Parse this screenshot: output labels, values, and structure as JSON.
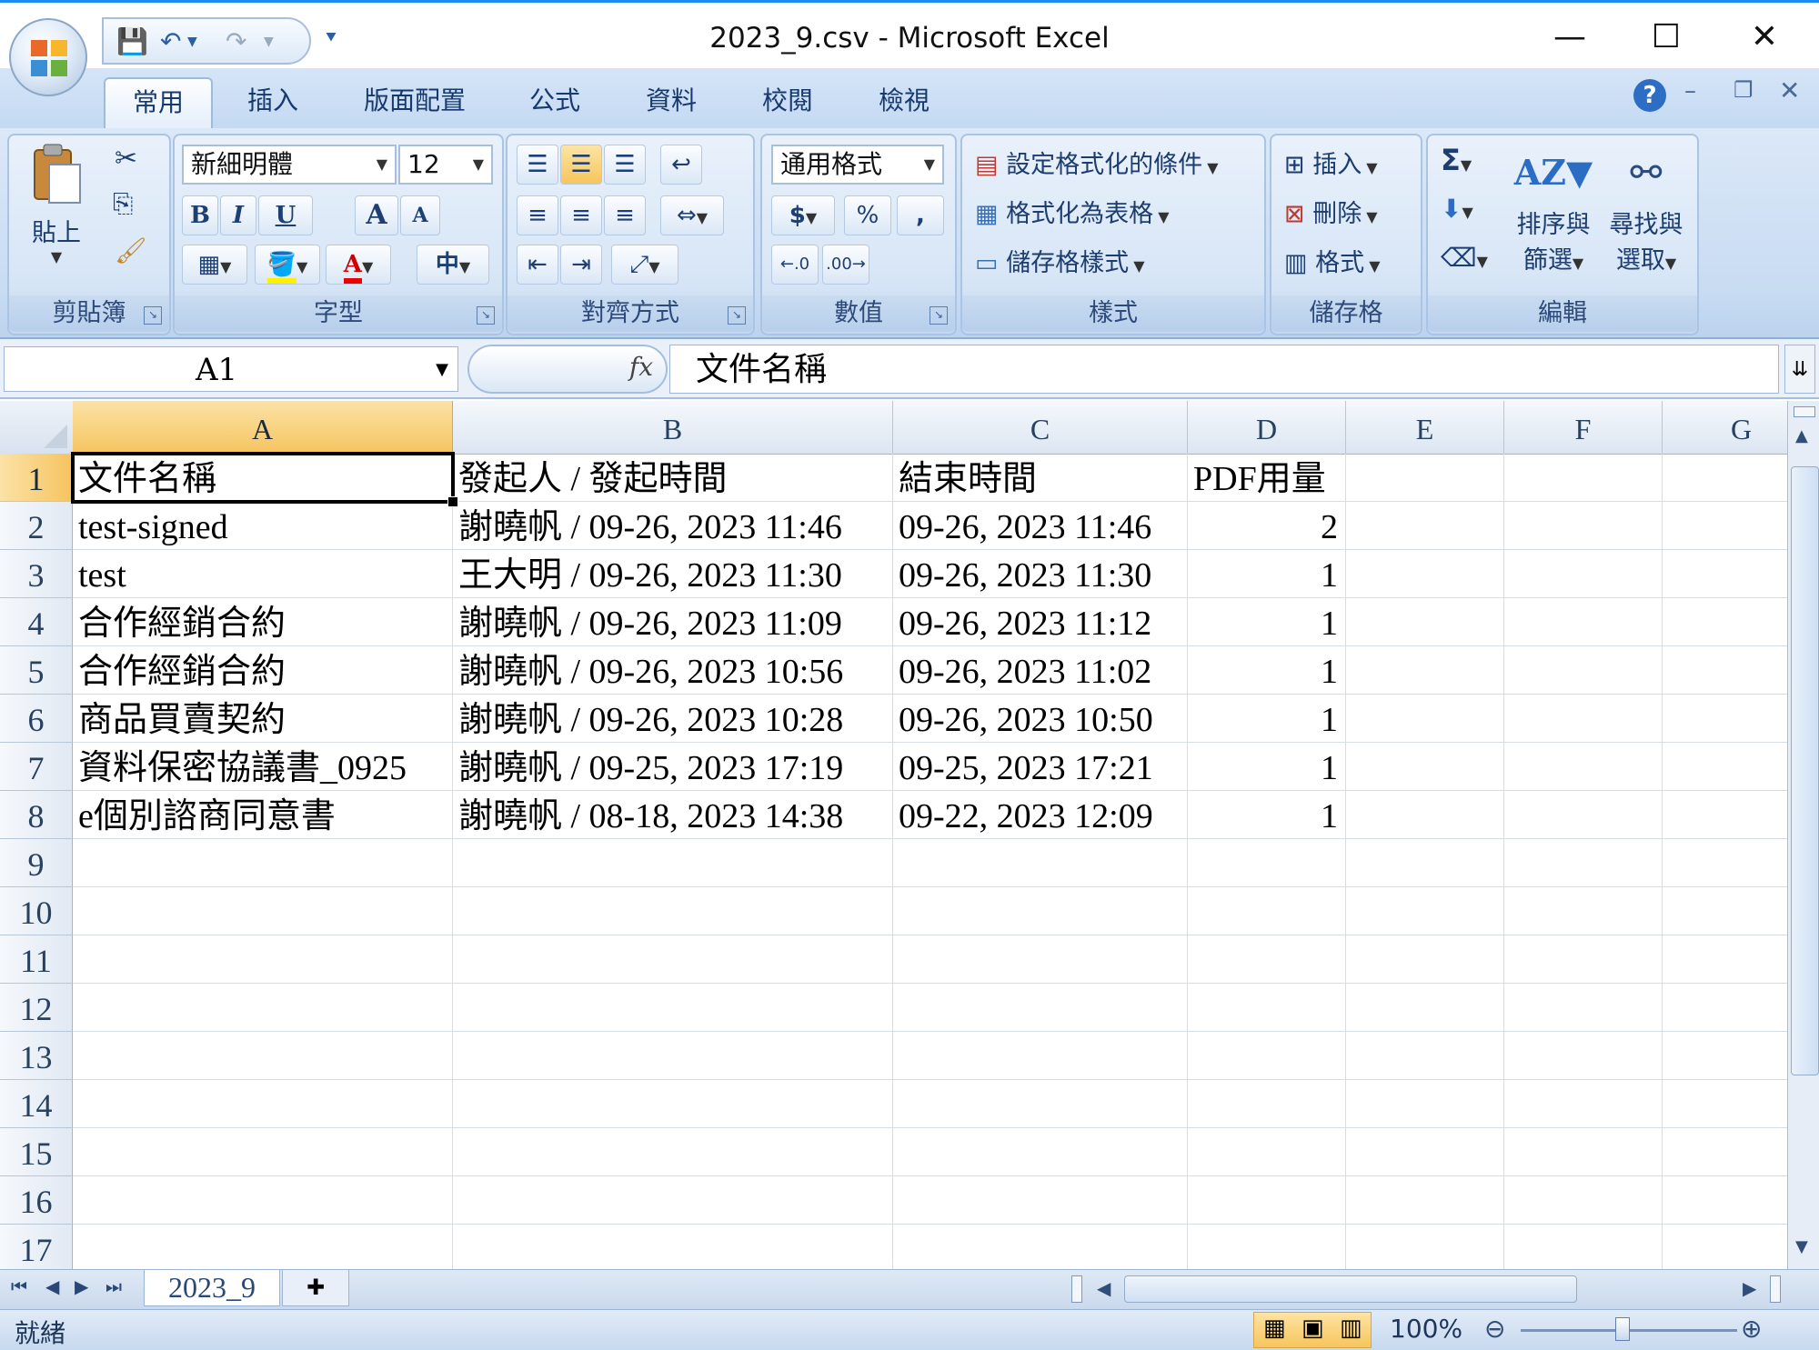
{
  "window": {
    "title": "2023_9.csv - Microsoft Excel",
    "minimize": "—",
    "maximize": "☐",
    "close": "✕"
  },
  "qat": {
    "save": "💾",
    "undo": "↶",
    "redo": "↷",
    "customize": "⯆"
  },
  "tabs": [
    "常用",
    "插入",
    "版面配置",
    "公式",
    "資料",
    "校閱",
    "檢視"
  ],
  "ribbon": {
    "clipboard": {
      "label": "剪貼簿",
      "paste": "貼上"
    },
    "font": {
      "label": "字型",
      "name": "新細明體",
      "size": "12",
      "bold": "B",
      "italic": "I",
      "underline": "U",
      "grow": "A",
      "shrink": "A",
      "phonetic": "中"
    },
    "alignment": {
      "label": "對齊方式"
    },
    "number": {
      "label": "數值",
      "format": "通用格式",
      "currency": "$",
      "percent": "%",
      "comma": ",",
      "inc": "←.0",
      "dec": ".00→"
    },
    "styles": {
      "label": "樣式",
      "conditional": "設定格式化的條件",
      "as_table": "格式化為表格",
      "cell_styles": "儲存格樣式"
    },
    "cells": {
      "label": "儲存格",
      "insert": "插入",
      "delete": "刪除",
      "format": "格式"
    },
    "editing": {
      "label": "編輯",
      "sum": "Σ",
      "sort_1": "排序與",
      "sort_2": "篩選",
      "find_1": "尋找與",
      "find_2": "選取"
    }
  },
  "formula_bar": {
    "name_box": "A1",
    "fx": "fx",
    "content": "文件名稱"
  },
  "sheet": {
    "columns": [
      "A",
      "B",
      "C",
      "D",
      "E",
      "F",
      "G"
    ],
    "row_numbers": [
      "1",
      "2",
      "3",
      "4",
      "5",
      "6",
      "7",
      "8",
      "9",
      "10",
      "11",
      "12",
      "13",
      "14",
      "15",
      "16",
      "17"
    ],
    "rows": [
      [
        "文件名稱",
        "發起人 / 發起時間",
        "結束時間",
        "PDF用量"
      ],
      [
        "test-signed",
        "謝曉帆 / 09-26, 2023 11:46",
        "09-26, 2023 11:46",
        "2"
      ],
      [
        "test",
        "王大明 / 09-26, 2023 11:30",
        "09-26, 2023 11:30",
        "1"
      ],
      [
        "合作經銷合約",
        "謝曉帆 / 09-26, 2023 11:09",
        "09-26, 2023 11:12",
        "1"
      ],
      [
        "合作經銷合約",
        "謝曉帆 / 09-26, 2023 10:56",
        "09-26, 2023 11:02",
        "1"
      ],
      [
        "商品買賣契約",
        "謝曉帆 / 09-26, 2023 10:28",
        "09-26, 2023 10:50",
        "1"
      ],
      [
        "資料保密協議書_0925",
        "謝曉帆 / 09-25, 2023 17:19",
        "09-25, 2023 17:21",
        "1"
      ],
      [
        "e個別諮商同意書",
        "謝曉帆 / 08-18, 2023 14:38",
        "09-22, 2023 12:09",
        "1"
      ]
    ]
  },
  "sheet_tabs": {
    "name": "2023_9"
  },
  "status_bar": {
    "ready": "就緒",
    "zoom": "100%"
  }
}
